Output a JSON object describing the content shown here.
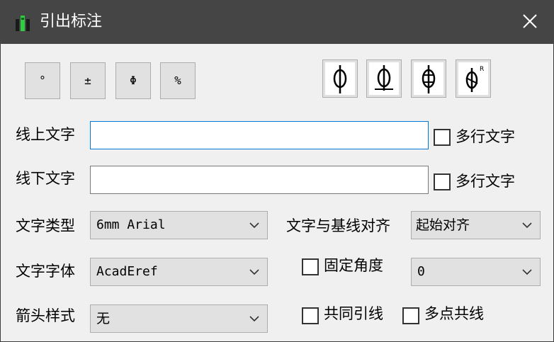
{
  "window": {
    "title": "引出标注",
    "close_icon": "close-icon"
  },
  "symbol_buttons": [
    {
      "name": "degree-symbol-button",
      "label": "°"
    },
    {
      "name": "plus-minus-symbol-button",
      "label": "±"
    },
    {
      "name": "diameter-symbol-button",
      "label": "Φ"
    },
    {
      "name": "percent-symbol-button",
      "label": "%"
    }
  ],
  "style_buttons": [
    {
      "name": "leader-style-1-button",
      "icon": "leader-style-1-icon"
    },
    {
      "name": "leader-style-2-button",
      "icon": "leader-style-2-icon"
    },
    {
      "name": "leader-style-3-button",
      "icon": "leader-style-3-icon"
    },
    {
      "name": "leader-style-4-button",
      "icon": "leader-style-4-icon"
    }
  ],
  "above_text": {
    "label": "线上文字",
    "value": "",
    "multiline_label": "多行文字",
    "multiline_checked": false
  },
  "below_text": {
    "label": "线下文字",
    "value": "",
    "multiline_label": "多行文字",
    "multiline_checked": false
  },
  "text_style": {
    "label": "文字类型",
    "value": "6mm Arial"
  },
  "baseline_align": {
    "label": "文字与基线对齐",
    "value": "起始对齐"
  },
  "text_font": {
    "label": "文字字体",
    "value": "AcadEref"
  },
  "fixed_angle": {
    "label": "固定角度",
    "checked": false,
    "value": "0"
  },
  "arrow_style": {
    "label": "箭头样式",
    "value": "无"
  },
  "common_leader": {
    "label": "共同引线",
    "checked": false
  },
  "multi_point": {
    "label": "多点共线",
    "checked": false
  },
  "colors": {
    "titlebar": "#454545",
    "focus_border": "#0078d7",
    "button_face": "#e1e1e1"
  }
}
